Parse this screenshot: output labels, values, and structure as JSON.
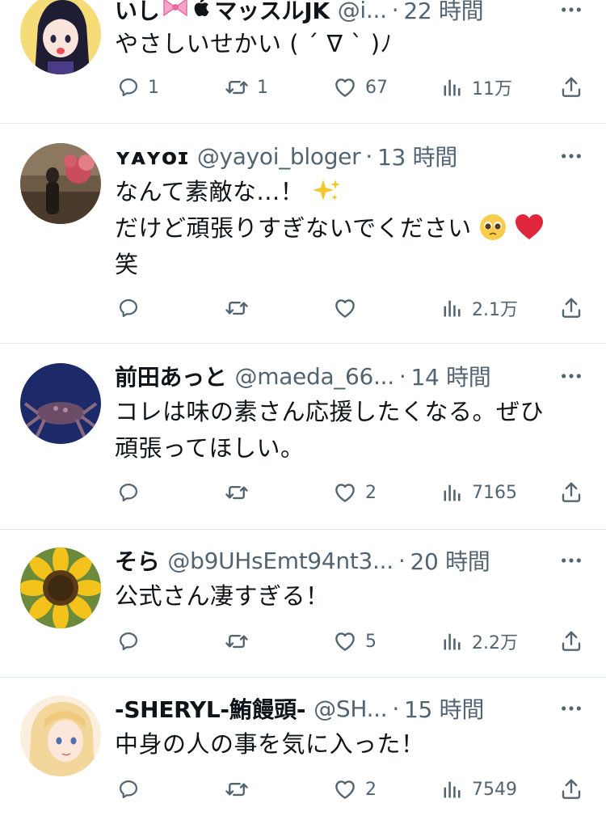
{
  "tweets": [
    {
      "name": "いし",
      "name_suffix": "マッスルJK",
      "handle": "@i...",
      "time": "22 時間",
      "text_lines": [
        "やさしいせかい ( ´ ∇ ` )ﾉ"
      ],
      "replies": "1",
      "retweets": "1",
      "likes": "67",
      "views": "11万"
    },
    {
      "name": "ʏᴀʏᴏɪ",
      "handle": "@yayoi_bloger",
      "time": "13 時間",
      "text_lines": [
        "なんて素敵な...！",
        "だけど頑張りすぎないでください",
        "笑"
      ],
      "replies": "",
      "retweets": "",
      "likes": "",
      "views": "2.1万"
    },
    {
      "name": "前田あっと",
      "handle": "@maeda_66...",
      "time": "14 時間",
      "text_lines": [
        "コレは味の素さん応援したくなる。ぜひ",
        "頑張ってほしい。"
      ],
      "replies": "",
      "retweets": "",
      "likes": "2",
      "views": "7165"
    },
    {
      "name": "そら",
      "handle": "@b9UHsEmt94nt3...",
      "time": "20 時間",
      "text_lines": [
        "公式さん凄すぎる！"
      ],
      "replies": "",
      "retweets": "",
      "likes": "5",
      "views": "2.2万"
    },
    {
      "name": "-SHERYL-鮪饅頭-",
      "handle": "@SH...",
      "time": "15 時間",
      "text_lines": [
        "中身の人の事を気に入った！"
      ],
      "replies": "",
      "retweets": "",
      "likes": "2",
      "views": "7549"
    }
  ],
  "icons": {
    "reply": "reply-icon",
    "retweet": "retweet-icon",
    "like": "heart-icon",
    "views": "views-icon",
    "share": "share-icon",
    "more": "more-icon"
  },
  "colors": {
    "text": "#0f1419",
    "secondary": "#536471",
    "divider": "#e1e6ea"
  }
}
